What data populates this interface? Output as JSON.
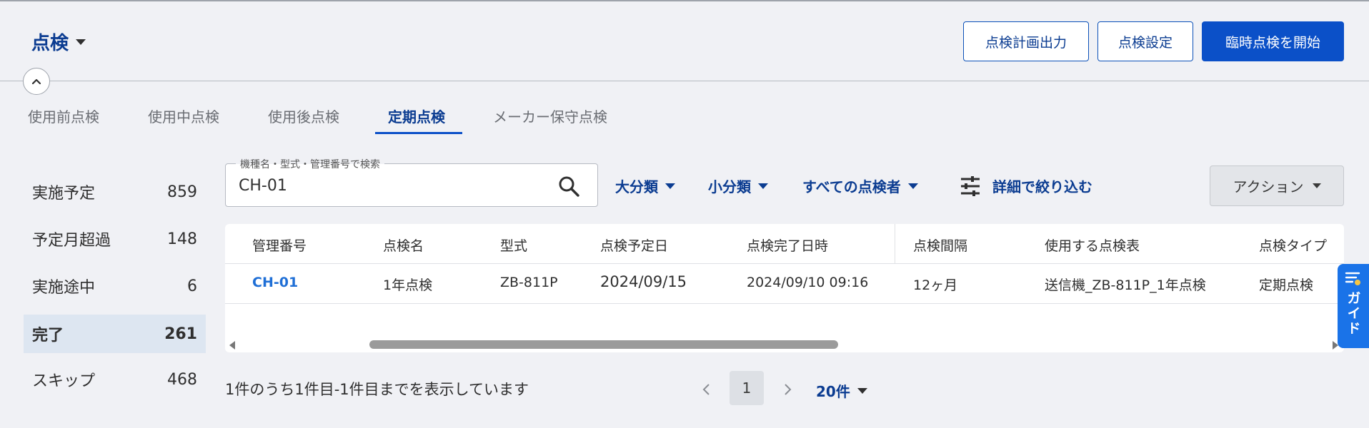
{
  "header": {
    "title": "点検",
    "buttons": {
      "plan_export": "点検計画出力",
      "settings": "点検設定",
      "start_temp": "臨時点検を開始"
    }
  },
  "tabs": [
    {
      "label": "使用前点検"
    },
    {
      "label": "使用中点検"
    },
    {
      "label": "使用後点検"
    },
    {
      "label": "定期点検",
      "active": true
    },
    {
      "label": "メーカー保守点検"
    }
  ],
  "sidebar": {
    "items": [
      {
        "label": "実施予定",
        "count": "859"
      },
      {
        "label": "予定月超過",
        "count": "148"
      },
      {
        "label": "実施途中",
        "count": "6"
      },
      {
        "label": "完了",
        "count": "261",
        "active": true
      },
      {
        "label": "スキップ",
        "count": "468"
      }
    ]
  },
  "search": {
    "label": "機種名・型式・管理番号で検索",
    "value": "CH-01"
  },
  "filters": {
    "major": "大分類",
    "minor": "小分類",
    "inspector": "すべての点検者",
    "detail": "詳細で絞り込む"
  },
  "action": {
    "label": "アクション"
  },
  "table": {
    "headers": [
      "管理番号",
      "点検名",
      "型式",
      "点検予定日",
      "点検完了日時",
      "点検間隔",
      "使用する点検表",
      "点検タイプ"
    ],
    "rows": [
      [
        "CH-01",
        "1年点検",
        "ZB-811P",
        "2024/09/15",
        "2024/09/10 09:16",
        "12ヶ月",
        "送信機_ZB-811P_1年点検",
        "定期点検"
      ]
    ]
  },
  "guide": {
    "label": "ガイド"
  },
  "pagination": {
    "summary": "1件のうち1件目-1件目までを表示しています",
    "current_page": "1",
    "per_page": "20件"
  },
  "colors": {
    "primary": "#0b50c8",
    "brand_text": "#0b3c91",
    "link": "#1f6fd6",
    "background": "#f0f1f5",
    "guide": "#1a73e8"
  }
}
